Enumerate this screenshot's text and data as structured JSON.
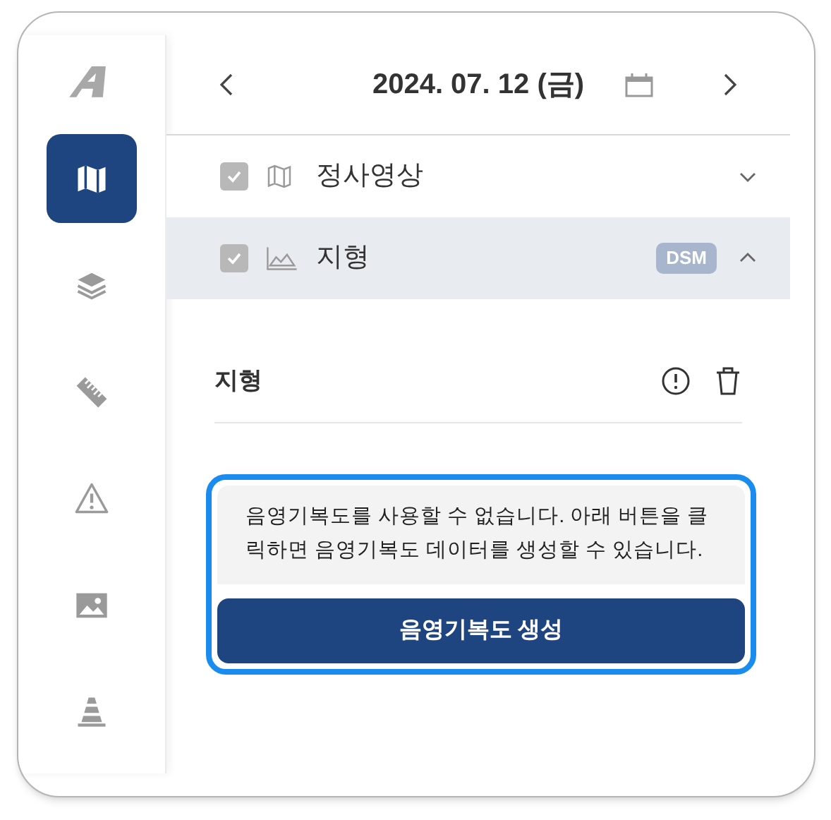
{
  "sidebar": {
    "items": [
      {
        "kind": "map",
        "selected": true
      },
      {
        "kind": "layers",
        "selected": false
      },
      {
        "kind": "ruler",
        "selected": false
      },
      {
        "kind": "warning",
        "selected": false
      },
      {
        "kind": "image",
        "selected": false
      },
      {
        "kind": "cone",
        "selected": false
      }
    ]
  },
  "header": {
    "date": "2024. 07. 12 (금)"
  },
  "layers": [
    {
      "kind": "map",
      "label": "정사영상",
      "checked": true,
      "expanded": false
    },
    {
      "kind": "terrain",
      "label": "지형",
      "checked": true,
      "expanded": true,
      "badge": "DSM"
    }
  ],
  "section": {
    "title": "지형"
  },
  "notice": {
    "message": "음영기복도를 사용할 수 없습니다. 아래 버튼을 클릭하면 음영기복도 데이터를 생성할 수 있습니다.",
    "button": "음영기복도 생성"
  }
}
